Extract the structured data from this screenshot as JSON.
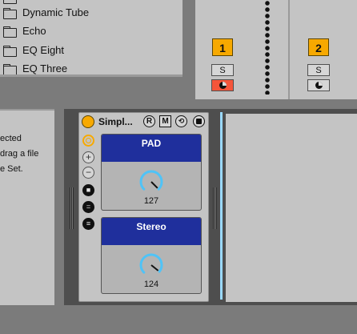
{
  "browser": {
    "items": [
      "",
      "Dynamic Tube",
      "Echo",
      "EQ Eight",
      "EQ Three"
    ]
  },
  "mixer": {
    "tracks": [
      {
        "number": "1",
        "solo_label": "S",
        "arm_color": "#f5553a"
      },
      {
        "number": "2",
        "solo_label": "S",
        "arm_color": "#d6d6d6"
      }
    ]
  },
  "info_panel": {
    "lines": [
      "ected",
      "drag a file",
      "e Set."
    ]
  },
  "device": {
    "name": "Simpl...",
    "header_buttons": {
      "rack": "R",
      "map": "M"
    },
    "macros": [
      {
        "label": "PAD",
        "value": "127",
        "fill": 1.0
      },
      {
        "label": "Stereo",
        "value": "124",
        "fill": 0.976
      }
    ]
  },
  "colors": {
    "accent": "#f7a900",
    "macro_header": "#1f2f9c",
    "knob_ring": "#4fc3f7",
    "insert_marker": "#9ad9ff",
    "arm_active": "#f5553a"
  },
  "icons": {
    "power": "device-power-icon",
    "hot_swap": "hot-swap-icon",
    "save": "save-preset-icon",
    "add": "add-macro-icon",
    "remove": "remove-macro-icon",
    "randomize": "randomize-icon",
    "variations": "variations-icon",
    "list": "macro-list-icon"
  }
}
